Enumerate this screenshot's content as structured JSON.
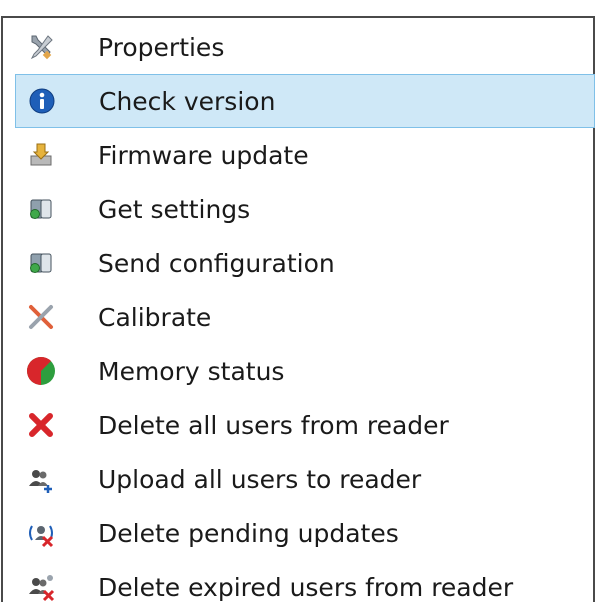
{
  "context_menu": {
    "items": [
      {
        "label": "Properties",
        "icon": "wrench-screwdriver-icon",
        "highlighted": false
      },
      {
        "label": "Check version",
        "icon": "info-icon",
        "highlighted": true
      },
      {
        "label": "Firmware update",
        "icon": "firmware-update-icon",
        "highlighted": false
      },
      {
        "label": "Get settings",
        "icon": "get-settings-icon",
        "highlighted": false
      },
      {
        "label": "Send configuration",
        "icon": "send-configuration-icon",
        "highlighted": false
      },
      {
        "label": "Calibrate",
        "icon": "calibrate-icon",
        "highlighted": false
      },
      {
        "label": "Memory status",
        "icon": "memory-status-icon",
        "highlighted": false
      },
      {
        "label": "Delete all users from reader",
        "icon": "delete-x-icon",
        "highlighted": false
      },
      {
        "label": "Upload all users to reader",
        "icon": "upload-users-icon",
        "highlighted": false
      },
      {
        "label": "Delete pending updates",
        "icon": "delete-pending-icon",
        "highlighted": false
      },
      {
        "label": "Delete expired users from reader",
        "icon": "delete-expired-users-icon",
        "highlighted": false
      }
    ],
    "highlight_color": "#cfe8f7",
    "highlight_border_color": "#7fc0e8"
  }
}
